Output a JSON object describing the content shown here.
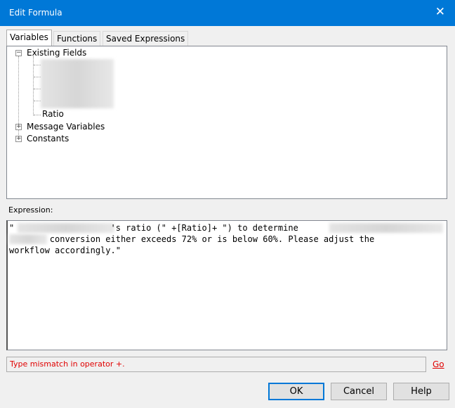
{
  "window": {
    "title": "Edit Formula"
  },
  "tabs": [
    "Variables",
    "Functions",
    "Saved Expressions"
  ],
  "tree": {
    "existing_fields": "Existing Fields",
    "ratio": "Ratio",
    "message_variables": "Message Variables",
    "constants": "Constants"
  },
  "expression": {
    "label": "Expression:",
    "line1": "\"                   's ratio (\" +[Ratio]+ \") to determine",
    "line2": "        conversion either exceeds 72% or is below 60%. Please adjust the",
    "line3": "workflow accordingly.\""
  },
  "error": "Type mismatch in operator +.",
  "go": "Go",
  "buttons": {
    "ok": "OK",
    "cancel": "Cancel",
    "help": "Help"
  }
}
